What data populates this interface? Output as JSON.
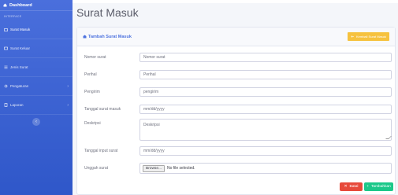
{
  "sidebar": {
    "brand": "Dashboard",
    "section_label": "INTERFACE",
    "items": [
      {
        "label": "Surat Masuk",
        "icon": "inbox-icon"
      },
      {
        "label": "Surat Keluar",
        "icon": "outbox-icon"
      },
      {
        "label": "Jenis Surat",
        "icon": "list-icon"
      },
      {
        "label": "Pengaturan",
        "icon": "settings-icon",
        "chevron": "›"
      },
      {
        "label": "Laporan",
        "icon": "report-icon",
        "chevron": "›"
      }
    ],
    "collapse_glyph": "‹"
  },
  "page": {
    "title": "Surat Masuk"
  },
  "card": {
    "title": "Tambah Surat Masuk",
    "header_button": "Kembali Surat Masuk"
  },
  "form": {
    "nomor": {
      "label": "Nomor surat",
      "placeholder": "Nomor surat"
    },
    "perihal": {
      "label": "Perihal",
      "placeholder": "Perihal"
    },
    "pengirim": {
      "label": "Pengirim",
      "placeholder": "pengirim"
    },
    "tgl_masuk": {
      "label": "Tanggal surat masuk",
      "value": "mm/dd/yyyy"
    },
    "deskripsi": {
      "label": "Deskripsi",
      "placeholder": "Deskripsi"
    },
    "tgl_input": {
      "label": "Tanggal input surat",
      "value": "mm/dd/yyyy"
    },
    "unggah": {
      "label": "Unggah surat",
      "browse": "Browse...",
      "status": "No file selected."
    }
  },
  "actions": {
    "cancel": "Batal",
    "submit": "Tambahkan"
  },
  "colors": {
    "primary": "#4e73df",
    "warning": "#f6c23e",
    "danger": "#e74a3b",
    "success": "#1cc88a"
  }
}
